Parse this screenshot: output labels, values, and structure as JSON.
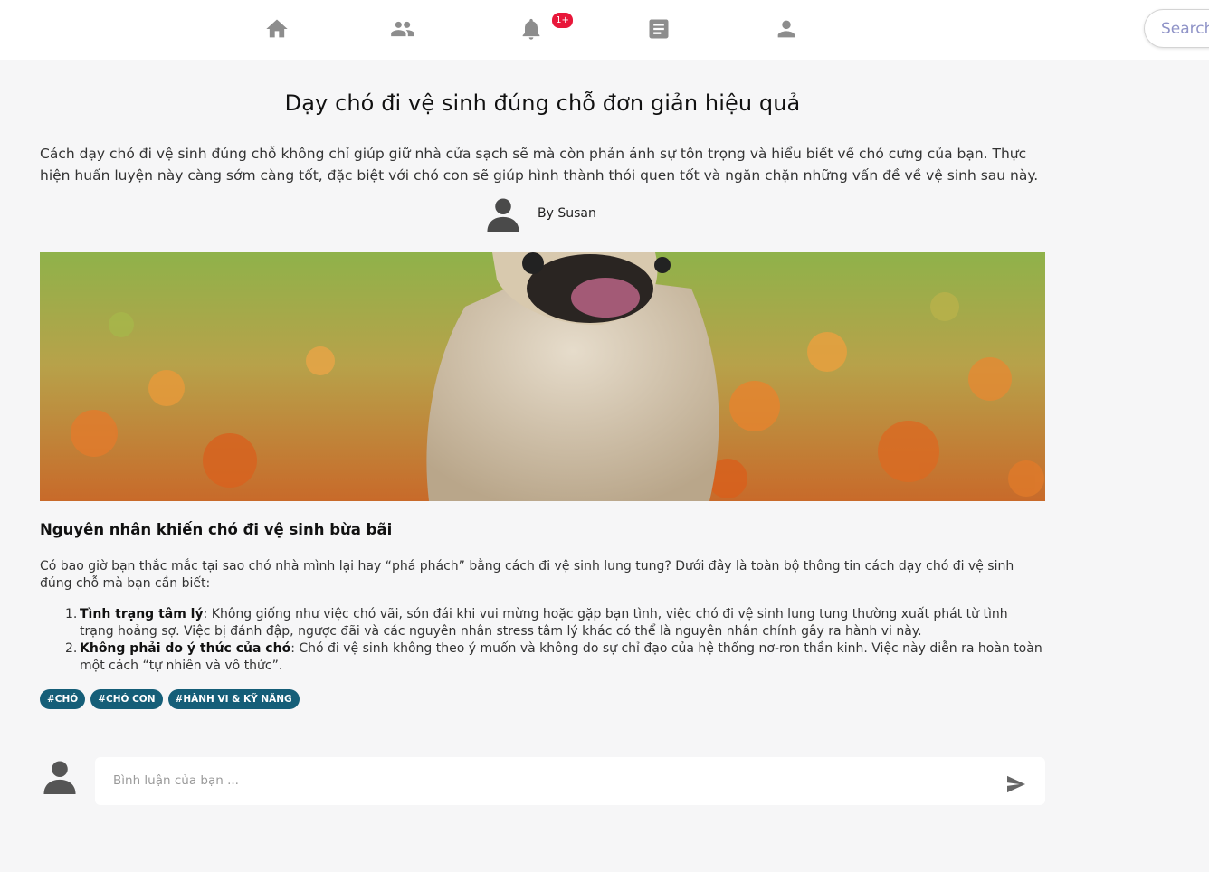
{
  "nav": {
    "items": [
      {
        "icon": "home-icon"
      },
      {
        "icon": "friends-icon"
      },
      {
        "icon": "bell-icon"
      },
      {
        "icon": "article-icon"
      },
      {
        "icon": "profile-icon"
      }
    ],
    "notification_badge": "1+",
    "search_placeholder": "Search"
  },
  "article": {
    "title": "Dạy chó đi vệ sinh đúng chỗ đơn giản hiệu quả",
    "lead": "Cách dạy chó đi vệ sinh đúng chỗ không chỉ giúp giữ nhà cửa sạch sẽ mà còn phản ánh sự tôn trọng và hiểu biết về chó cưng của bạn. Thực hiện huấn luyện này càng sớm càng tốt, đặc biệt với chó con sẽ giúp hình thành thói quen tốt và ngăn chặn những vấn đề về vệ sinh sau này.",
    "author": "By Susan",
    "section_heading": "Nguyên nhân khiến chó đi vệ sinh bừa bãi",
    "paragraph": "Có bao giờ bạn thắc mắc tại sao chó nhà mình lại hay “phá phách” bằng cách đi vệ sinh lung tung? Dưới đây là toàn bộ thông tin cách dạy chó đi vệ sinh đúng chỗ mà bạn cần biết:",
    "list": [
      {
        "num": "1.",
        "bold": " Tình trạng tâm lý",
        "text": ": Không giống như việc chó vãi, són đái khi vui mừng hoặc gặp bạn tình, việc chó đi vệ sinh lung tung thường xuất phát từ tình trạng hoảng sợ. Việc bị đánh đập, ngược đãi và các nguyên nhân stress tâm lý khác có thể là nguyên nhân chính gây ra hành vi này."
      },
      {
        "num": "2.",
        "bold": "Không phải do ý thức của chó",
        "text": ": Chó đi vệ sinh không theo ý muốn và không do sự chỉ đạo của hệ thống nơ-ron thần kinh. Việc này diễn ra hoàn toàn một cách “tự nhiên và vô thức”."
      }
    ],
    "tags": [
      "#CHÓ",
      "#CHÓ CON",
      "#HÀNH VI & KỸ NĂNG"
    ]
  },
  "comment": {
    "placeholder": "Bình luận của bạn ..."
  },
  "colors": {
    "tag": "#155e78",
    "badge": "#e8173a",
    "nav_icon": "#8d8d8d"
  }
}
